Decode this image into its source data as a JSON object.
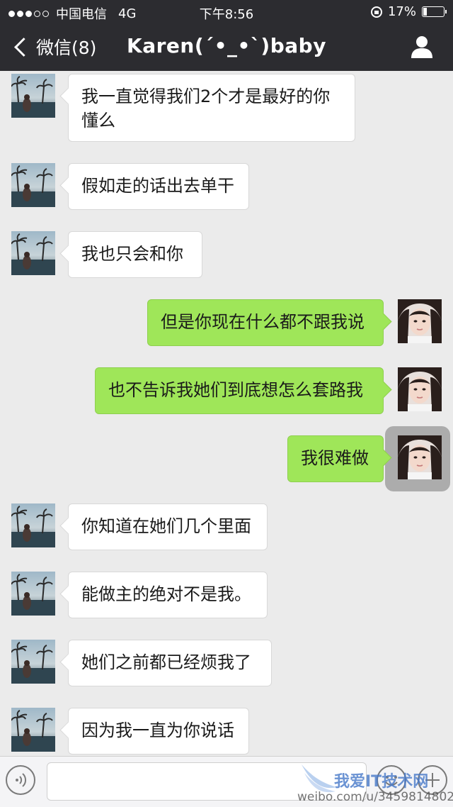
{
  "status_bar": {
    "carrier": "中国电信",
    "network": "4G",
    "time": "下午8:56",
    "battery_percent_text": "17%",
    "battery_level": 0.17
  },
  "nav": {
    "back_label": "微信(8)",
    "title": "Karen(´•_•`)baby",
    "profile_icon": "person-icon"
  },
  "messages": [
    {
      "side": "in",
      "text": "我一直觉得我们2个才是最好的你懂么"
    },
    {
      "side": "in",
      "text": "假如走的话出去单干"
    },
    {
      "side": "in",
      "text": "我也只会和你"
    },
    {
      "side": "out",
      "text": "但是你现在什么都不跟我说"
    },
    {
      "side": "out",
      "text": "也不告诉我她们到底想怎么套路我"
    },
    {
      "side": "out",
      "text": "我很难做",
      "avatar_pressed": true
    },
    {
      "side": "in",
      "text": "你知道在她们几个里面"
    },
    {
      "side": "in",
      "text": "能做主的绝对不是我。"
    },
    {
      "side": "in",
      "text": "她们之前都已经烦我了"
    },
    {
      "side": "in",
      "text": "因为我一直为你说话"
    }
  ],
  "input_bar": {
    "voice_icon": "voice-icon",
    "emoji_icon": "emoji-icon",
    "plus_icon": "plus-icon"
  },
  "watermark": {
    "logo_text": "我爱IT技术网",
    "url_text": "weibo.com/u/3459814802"
  },
  "colors": {
    "nav_bg": "#2c2c30",
    "chat_bg": "#ebebeb",
    "out_bubble": "#9fe659",
    "in_bubble": "#ffffff"
  }
}
